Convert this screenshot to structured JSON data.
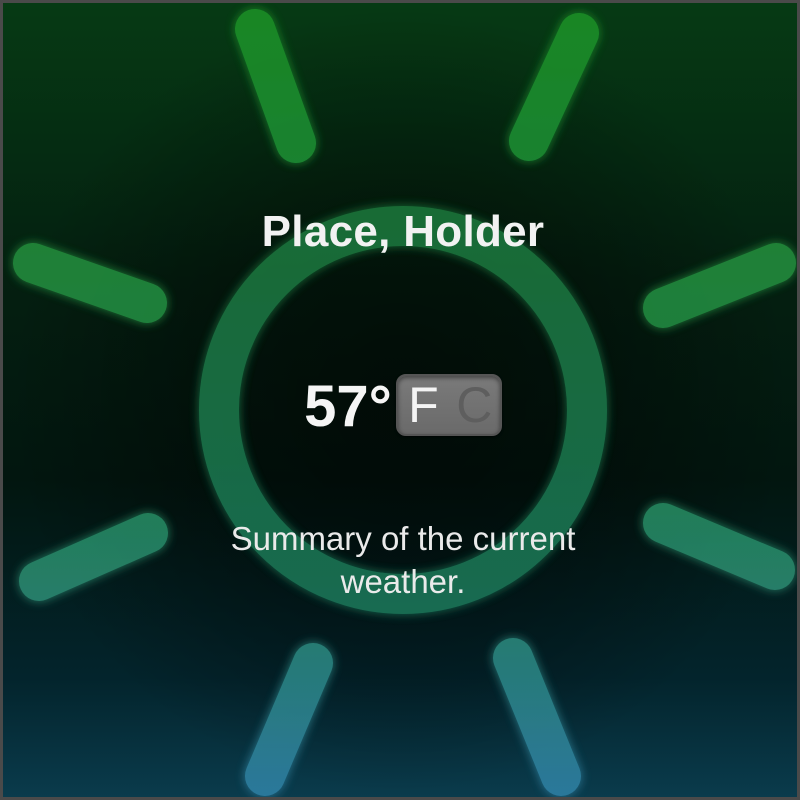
{
  "location": "Place, Holder",
  "temperature": {
    "value": "57°",
    "units": [
      "F",
      "C"
    ],
    "selected_unit": "F"
  },
  "summary": "Summary of the current weather.",
  "colors": {
    "ray_top": "#1c8a2a",
    "ray_middle": "#2a8a5a",
    "ray_bottom": "#2f7fa0",
    "ring": "#1f7a45",
    "toggle": "#707070"
  },
  "decoration": {
    "sun_icon": "sun-rays-icon"
  }
}
